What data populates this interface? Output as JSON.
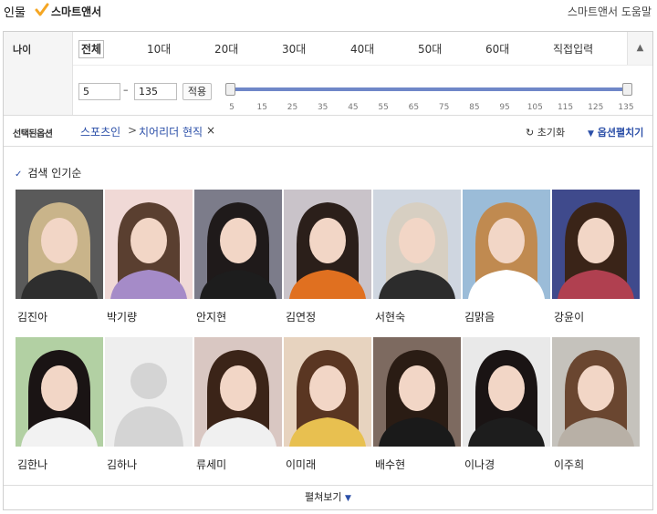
{
  "header": {
    "title": "인물",
    "smart_answer_label": "스마트앤서",
    "help_link": "스마트앤서 도움말"
  },
  "age_filter": {
    "label": "나이",
    "tabs": [
      "전체",
      "10대",
      "20대",
      "30대",
      "40대",
      "50대",
      "60대",
      "직접입력"
    ],
    "active_tab": "전체",
    "collapse_icon": "chevron-up-icon",
    "min_value": "5",
    "max_value": "135",
    "range_dash": "–",
    "apply_label": "적용",
    "slider_range": [
      5,
      135
    ],
    "ticks": [
      "5",
      "15",
      "25",
      "35",
      "45",
      "55",
      "65",
      "75",
      "85",
      "95",
      "105",
      "115",
      "125",
      "135"
    ]
  },
  "selected_options": {
    "label": "선택된옵션",
    "crumb_1": "스포츠인",
    "crumb_sep": ">",
    "crumb_2": "치어리더 현직",
    "remove_icon": "×",
    "reset_label": "초기화",
    "expand_label": "옵션펼치기"
  },
  "sort": {
    "label": "검색 인기순",
    "check_icon": "✓"
  },
  "people": [
    {
      "name": "김진아"
    },
    {
      "name": "박기량"
    },
    {
      "name": "안지현"
    },
    {
      "name": "김연정"
    },
    {
      "name": "서현숙"
    },
    {
      "name": "김맑음"
    },
    {
      "name": "강윤이"
    },
    {
      "name": "김한나"
    },
    {
      "name": "김하나"
    },
    {
      "name": "류세미"
    },
    {
      "name": "이미래"
    },
    {
      "name": "배수현"
    },
    {
      "name": "이나경"
    },
    {
      "name": "이주희"
    }
  ],
  "more_label": "펼쳐보기",
  "colors": {
    "accent_blue": "#2b4fa8",
    "slider": "#6f87c8",
    "smart_answer_check": "#f5a623"
  }
}
